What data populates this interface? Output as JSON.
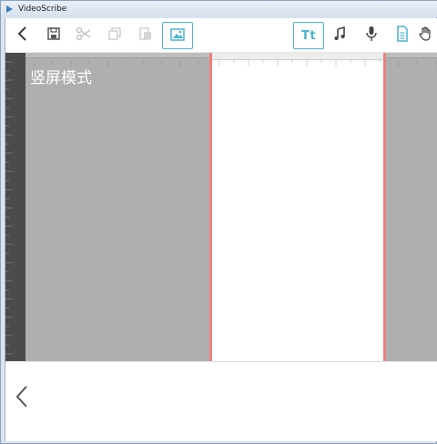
{
  "window": {
    "title": "VideoScribe"
  },
  "menu": {
    "items": [
      "",
      "",
      "",
      "",
      "",
      "",
      "",
      ""
    ]
  },
  "toolbar": {
    "back": "back",
    "save": "save",
    "cut": "cut",
    "copy": "copy",
    "paste": "paste",
    "add_image": "add image",
    "add_text_label": "Tt",
    "music": "music",
    "voiceover": "voiceover",
    "document": "document",
    "hand": "hand"
  },
  "canvas": {
    "mode_label": "竖屏模式"
  },
  "colors": {
    "accent": "#4bb3d1",
    "canvas_border": "#ef7f7f",
    "workspace": "#afafaf",
    "ruler_dark": "#4b4b4b"
  },
  "icons": [
    "back-icon",
    "save-icon",
    "scissors-icon",
    "copy-icon",
    "paste-icon",
    "image-icon",
    "music-note-icon",
    "microphone-icon",
    "document-icon",
    "hand-icon",
    "chevron-left-icon"
  ]
}
